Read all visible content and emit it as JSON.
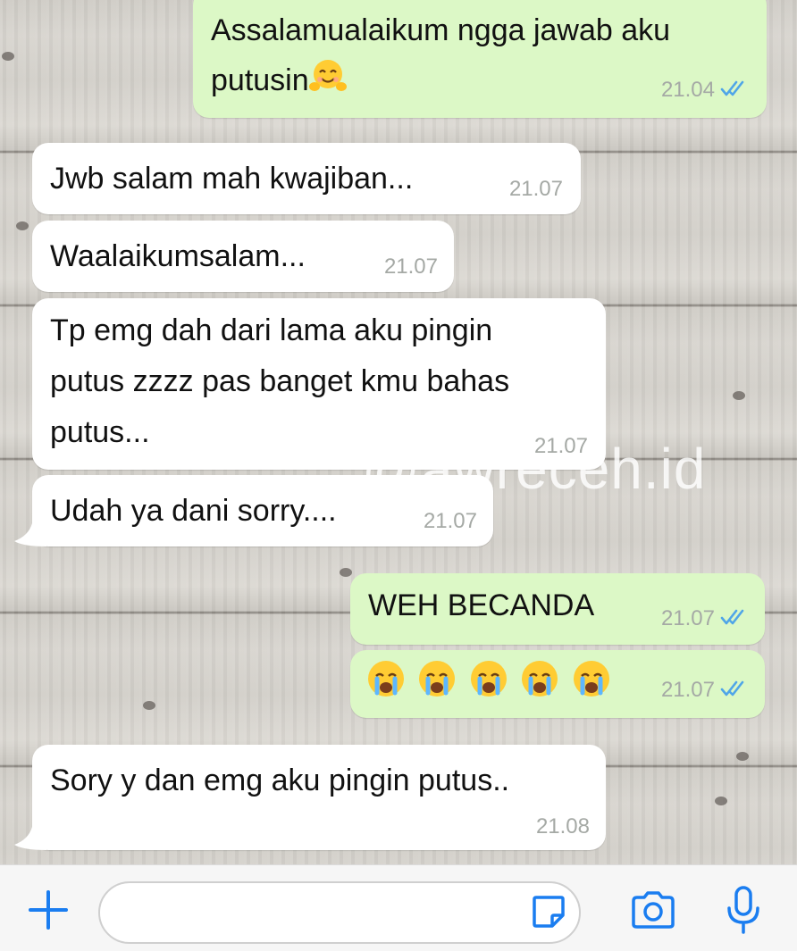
{
  "messages": [
    {
      "id": "m1",
      "direction": "outgoing",
      "text": "Assalamualaikum ngga jawab aku",
      "text2": "putusin",
      "emoji": "smiling-hug-emoji",
      "time": "21.04",
      "status": "read"
    },
    {
      "id": "m2",
      "direction": "incoming",
      "text": "Jwb salam mah kwajiban...",
      "time": "21.07"
    },
    {
      "id": "m3",
      "direction": "incoming",
      "text": "Waalaikumsalam...",
      "time": "21.07"
    },
    {
      "id": "m4",
      "direction": "incoming",
      "lines": [
        "Tp emg dah dari lama aku pingin",
        "putus zzzz pas banget kmu bahas",
        "putus..."
      ],
      "time": "21.07"
    },
    {
      "id": "m5",
      "direction": "incoming",
      "text": "Udah ya dani sorry....",
      "time": "21.07"
    },
    {
      "id": "m6",
      "direction": "outgoing",
      "text": "WEH BECANDA",
      "time": "21.07",
      "status": "read"
    },
    {
      "id": "m7",
      "direction": "outgoing",
      "emoji_row": [
        "crying-face-emoji",
        "crying-face-emoji",
        "crying-face-emoji",
        "crying-face-emoji",
        "crying-face-emoji"
      ],
      "time": "21.07",
      "status": "read"
    },
    {
      "id": "m8",
      "direction": "incoming",
      "text": "Sory y dan emg aku pingin putus..",
      "time": "21.08"
    }
  ],
  "watermark": "@awreceh.id",
  "input_bar": {
    "icons": [
      "plus-icon",
      "sticker-icon",
      "camera-icon",
      "microphone-icon"
    ],
    "accent_color": "#1a7df0"
  },
  "colors": {
    "incoming_bubble": "#ffffff",
    "outgoing_bubble": "#dcf8c6",
    "read_tick": "#4fa5e8"
  }
}
